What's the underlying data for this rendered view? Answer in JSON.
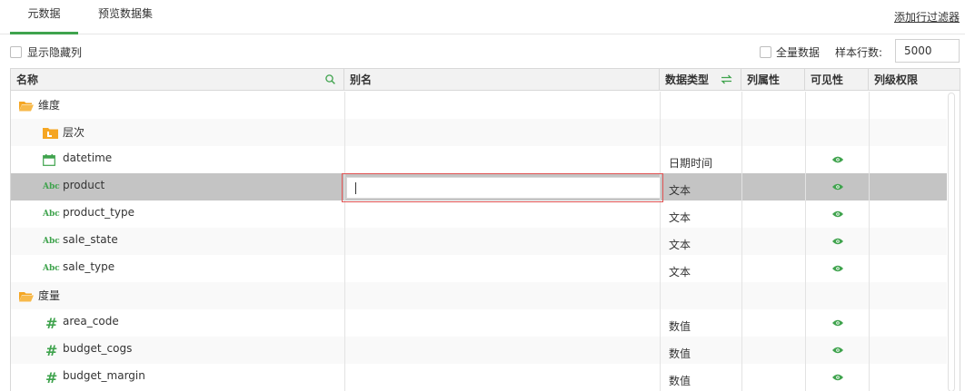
{
  "tabs": [
    {
      "label": "元数据",
      "active": true
    },
    {
      "label": "预览数据集",
      "active": false
    }
  ],
  "add_filter_label": "添加行过滤器",
  "toolbar": {
    "show_hidden_label": "显示隐藏列",
    "all_data_label": "全量数据",
    "sample_rows_label": "样本行数:",
    "sample_rows_value": "5000"
  },
  "columns": {
    "name": "名称",
    "alias": "别名",
    "type": "数据类型",
    "attribute": "列属性",
    "visibility": "可见性",
    "permission": "列级权限"
  },
  "rows": [
    {
      "name": "维度",
      "icon": "folder-open-icon",
      "level": 0,
      "type": "",
      "visible": false
    },
    {
      "name": "层次",
      "icon": "hierarchy-folder-icon",
      "level": 1,
      "type": "",
      "visible": true
    },
    {
      "name": "datetime",
      "icon": "calendar-icon",
      "level": 1,
      "type": "日期时间",
      "visible": true
    },
    {
      "name": "product",
      "icon": "text-abc-icon",
      "level": 1,
      "type": "文本",
      "visible": true,
      "selected": true
    },
    {
      "name": "product_type",
      "icon": "text-abc-icon",
      "level": 1,
      "type": "文本",
      "visible": true
    },
    {
      "name": "sale_state",
      "icon": "text-abc-icon",
      "level": 1,
      "type": "文本",
      "visible": true
    },
    {
      "name": "sale_type",
      "icon": "text-abc-icon",
      "level": 1,
      "type": "文本",
      "visible": true
    },
    {
      "name": "度量",
      "icon": "folder-open-icon",
      "level": 0,
      "type": "",
      "visible": false
    },
    {
      "name": "area_code",
      "icon": "number-hash-icon",
      "level": 1,
      "type": "数值",
      "visible": true
    },
    {
      "name": "budget_cogs",
      "icon": "number-hash-icon",
      "level": 1,
      "type": "数值",
      "visible": true
    },
    {
      "name": "budget_margin",
      "icon": "number-hash-icon",
      "level": 1,
      "type": "数值",
      "visible": true
    }
  ],
  "colors": {
    "accent": "#3fa34d",
    "selected_row": "#c4c4c4",
    "folder": "#f5a623",
    "edit_border": "#e05252"
  }
}
